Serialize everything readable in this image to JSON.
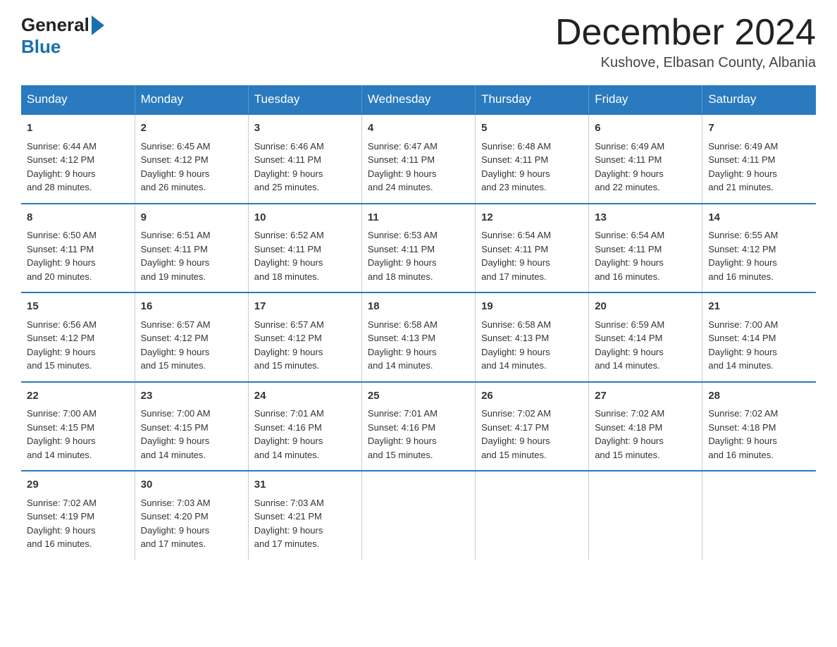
{
  "logo": {
    "general": "General",
    "blue": "Blue"
  },
  "title": "December 2024",
  "location": "Kushove, Elbasan County, Albania",
  "headers": [
    "Sunday",
    "Monday",
    "Tuesday",
    "Wednesday",
    "Thursday",
    "Friday",
    "Saturday"
  ],
  "weeks": [
    [
      {
        "num": "1",
        "sunrise": "6:44 AM",
        "sunset": "4:12 PM",
        "daylight": "9 hours and 28 minutes."
      },
      {
        "num": "2",
        "sunrise": "6:45 AM",
        "sunset": "4:12 PM",
        "daylight": "9 hours and 26 minutes."
      },
      {
        "num": "3",
        "sunrise": "6:46 AM",
        "sunset": "4:11 PM",
        "daylight": "9 hours and 25 minutes."
      },
      {
        "num": "4",
        "sunrise": "6:47 AM",
        "sunset": "4:11 PM",
        "daylight": "9 hours and 24 minutes."
      },
      {
        "num": "5",
        "sunrise": "6:48 AM",
        "sunset": "4:11 PM",
        "daylight": "9 hours and 23 minutes."
      },
      {
        "num": "6",
        "sunrise": "6:49 AM",
        "sunset": "4:11 PM",
        "daylight": "9 hours and 22 minutes."
      },
      {
        "num": "7",
        "sunrise": "6:49 AM",
        "sunset": "4:11 PM",
        "daylight": "9 hours and 21 minutes."
      }
    ],
    [
      {
        "num": "8",
        "sunrise": "6:50 AM",
        "sunset": "4:11 PM",
        "daylight": "9 hours and 20 minutes."
      },
      {
        "num": "9",
        "sunrise": "6:51 AM",
        "sunset": "4:11 PM",
        "daylight": "9 hours and 19 minutes."
      },
      {
        "num": "10",
        "sunrise": "6:52 AM",
        "sunset": "4:11 PM",
        "daylight": "9 hours and 18 minutes."
      },
      {
        "num": "11",
        "sunrise": "6:53 AM",
        "sunset": "4:11 PM",
        "daylight": "9 hours and 18 minutes."
      },
      {
        "num": "12",
        "sunrise": "6:54 AM",
        "sunset": "4:11 PM",
        "daylight": "9 hours and 17 minutes."
      },
      {
        "num": "13",
        "sunrise": "6:54 AM",
        "sunset": "4:11 PM",
        "daylight": "9 hours and 16 minutes."
      },
      {
        "num": "14",
        "sunrise": "6:55 AM",
        "sunset": "4:12 PM",
        "daylight": "9 hours and 16 minutes."
      }
    ],
    [
      {
        "num": "15",
        "sunrise": "6:56 AM",
        "sunset": "4:12 PM",
        "daylight": "9 hours and 15 minutes."
      },
      {
        "num": "16",
        "sunrise": "6:57 AM",
        "sunset": "4:12 PM",
        "daylight": "9 hours and 15 minutes."
      },
      {
        "num": "17",
        "sunrise": "6:57 AM",
        "sunset": "4:12 PM",
        "daylight": "9 hours and 15 minutes."
      },
      {
        "num": "18",
        "sunrise": "6:58 AM",
        "sunset": "4:13 PM",
        "daylight": "9 hours and 14 minutes."
      },
      {
        "num": "19",
        "sunrise": "6:58 AM",
        "sunset": "4:13 PM",
        "daylight": "9 hours and 14 minutes."
      },
      {
        "num": "20",
        "sunrise": "6:59 AM",
        "sunset": "4:14 PM",
        "daylight": "9 hours and 14 minutes."
      },
      {
        "num": "21",
        "sunrise": "7:00 AM",
        "sunset": "4:14 PM",
        "daylight": "9 hours and 14 minutes."
      }
    ],
    [
      {
        "num": "22",
        "sunrise": "7:00 AM",
        "sunset": "4:15 PM",
        "daylight": "9 hours and 14 minutes."
      },
      {
        "num": "23",
        "sunrise": "7:00 AM",
        "sunset": "4:15 PM",
        "daylight": "9 hours and 14 minutes."
      },
      {
        "num": "24",
        "sunrise": "7:01 AM",
        "sunset": "4:16 PM",
        "daylight": "9 hours and 14 minutes."
      },
      {
        "num": "25",
        "sunrise": "7:01 AM",
        "sunset": "4:16 PM",
        "daylight": "9 hours and 15 minutes."
      },
      {
        "num": "26",
        "sunrise": "7:02 AM",
        "sunset": "4:17 PM",
        "daylight": "9 hours and 15 minutes."
      },
      {
        "num": "27",
        "sunrise": "7:02 AM",
        "sunset": "4:18 PM",
        "daylight": "9 hours and 15 minutes."
      },
      {
        "num": "28",
        "sunrise": "7:02 AM",
        "sunset": "4:18 PM",
        "daylight": "9 hours and 16 minutes."
      }
    ],
    [
      {
        "num": "29",
        "sunrise": "7:02 AM",
        "sunset": "4:19 PM",
        "daylight": "9 hours and 16 minutes."
      },
      {
        "num": "30",
        "sunrise": "7:03 AM",
        "sunset": "4:20 PM",
        "daylight": "9 hours and 17 minutes."
      },
      {
        "num": "31",
        "sunrise": "7:03 AM",
        "sunset": "4:21 PM",
        "daylight": "9 hours and 17 minutes."
      },
      null,
      null,
      null,
      null
    ]
  ],
  "labels": {
    "sunrise_prefix": "Sunrise: ",
    "sunset_prefix": "Sunset: ",
    "daylight_prefix": "Daylight: "
  }
}
